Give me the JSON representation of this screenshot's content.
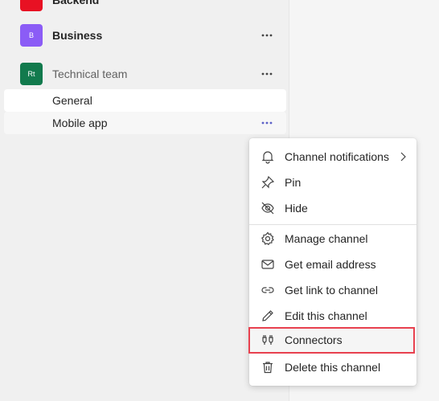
{
  "teams": [
    {
      "name": "Backend",
      "avatar_text": "",
      "avatar_color": "#e81123"
    },
    {
      "name": "Business",
      "avatar_text": "B",
      "avatar_color": "#8b5cf6"
    },
    {
      "name": "Technical team",
      "avatar_text": "Rt",
      "avatar_color": "#127a4d"
    }
  ],
  "channels": [
    "General",
    "Mobile app"
  ],
  "context_menu": {
    "items": [
      {
        "label": "Channel notifications",
        "icon": "bell-icon",
        "has_submenu": true
      },
      {
        "label": "Pin",
        "icon": "pin-icon"
      },
      {
        "label": "Hide",
        "icon": "eye-off-icon"
      },
      {
        "label": "Manage channel",
        "icon": "gear-icon"
      },
      {
        "label": "Get email address",
        "icon": "mail-icon"
      },
      {
        "label": "Get link to channel",
        "icon": "link-icon"
      },
      {
        "label": "Edit this channel",
        "icon": "pencil-icon"
      },
      {
        "label": "Connectors",
        "icon": "plug-icon",
        "highlighted": true
      },
      {
        "label": "Delete this channel",
        "icon": "trash-icon"
      }
    ]
  },
  "colors": {
    "accent": "#5b5fc7",
    "highlight_border": "#e8414f"
  }
}
